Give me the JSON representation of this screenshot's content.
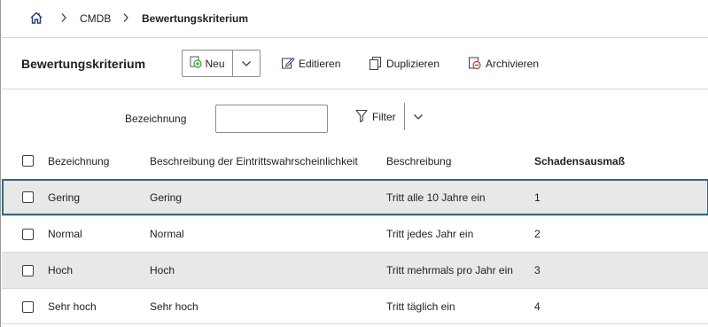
{
  "breadcrumb": {
    "home_icon": "home-icon",
    "items": [
      "CMDB"
    ],
    "current": "Bewertungskriterium"
  },
  "header": {
    "title": "Bewertungskriterium",
    "new_label": "Neu",
    "edit_label": "Editieren",
    "duplicate_label": "Duplizieren",
    "archive_label": "Archivieren"
  },
  "filter": {
    "label": "Bezeichnung",
    "value": "",
    "placeholder": "",
    "button_label": "Filter"
  },
  "table": {
    "columns": [
      "Bezeichnung",
      "Beschreibung der Eintrittswahrscheinlichkeit",
      "Beschreibung",
      "Schadensausmaß"
    ],
    "rows": [
      {
        "name": "Gering",
        "prob_desc": "Gering",
        "desc": "Tritt alle 10 Jahre ein",
        "damage": "1"
      },
      {
        "name": "Normal",
        "prob_desc": "Normal",
        "desc": "Tritt jedes Jahr ein",
        "damage": "2"
      },
      {
        "name": "Hoch",
        "prob_desc": "Hoch",
        "desc": "Tritt mehrmals pro Jahr ein",
        "damage": "3"
      },
      {
        "name": "Sehr hoch",
        "prob_desc": "Sehr hoch",
        "desc": "Tritt täglich ein",
        "damage": "4"
      }
    ]
  },
  "colors": {
    "selected_row_border": "#336a7c",
    "alt_row_bg": "#e8e8e8",
    "new_icon_green": "#3a9a3a",
    "archive_icon_red": "#c0392b"
  }
}
